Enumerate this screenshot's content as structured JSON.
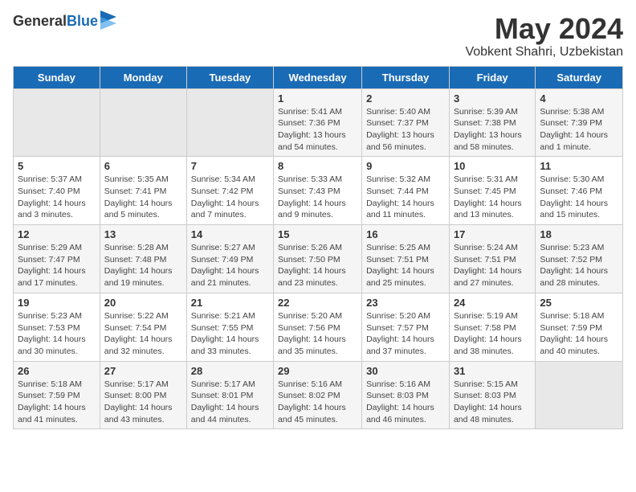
{
  "logo": {
    "general": "General",
    "blue": "Blue"
  },
  "title": "May 2024",
  "location": "Vobkent Shahri, Uzbekistan",
  "days_of_week": [
    "Sunday",
    "Monday",
    "Tuesday",
    "Wednesday",
    "Thursday",
    "Friday",
    "Saturday"
  ],
  "weeks": [
    [
      {
        "day": "",
        "info": ""
      },
      {
        "day": "",
        "info": ""
      },
      {
        "day": "",
        "info": ""
      },
      {
        "day": "1",
        "info": "Sunrise: 5:41 AM\nSunset: 7:36 PM\nDaylight: 13 hours\nand 54 minutes."
      },
      {
        "day": "2",
        "info": "Sunrise: 5:40 AM\nSunset: 7:37 PM\nDaylight: 13 hours\nand 56 minutes."
      },
      {
        "day": "3",
        "info": "Sunrise: 5:39 AM\nSunset: 7:38 PM\nDaylight: 13 hours\nand 58 minutes."
      },
      {
        "day": "4",
        "info": "Sunrise: 5:38 AM\nSunset: 7:39 PM\nDaylight: 14 hours\nand 1 minute."
      }
    ],
    [
      {
        "day": "5",
        "info": "Sunrise: 5:37 AM\nSunset: 7:40 PM\nDaylight: 14 hours\nand 3 minutes."
      },
      {
        "day": "6",
        "info": "Sunrise: 5:35 AM\nSunset: 7:41 PM\nDaylight: 14 hours\nand 5 minutes."
      },
      {
        "day": "7",
        "info": "Sunrise: 5:34 AM\nSunset: 7:42 PM\nDaylight: 14 hours\nand 7 minutes."
      },
      {
        "day": "8",
        "info": "Sunrise: 5:33 AM\nSunset: 7:43 PM\nDaylight: 14 hours\nand 9 minutes."
      },
      {
        "day": "9",
        "info": "Sunrise: 5:32 AM\nSunset: 7:44 PM\nDaylight: 14 hours\nand 11 minutes."
      },
      {
        "day": "10",
        "info": "Sunrise: 5:31 AM\nSunset: 7:45 PM\nDaylight: 14 hours\nand 13 minutes."
      },
      {
        "day": "11",
        "info": "Sunrise: 5:30 AM\nSunset: 7:46 PM\nDaylight: 14 hours\nand 15 minutes."
      }
    ],
    [
      {
        "day": "12",
        "info": "Sunrise: 5:29 AM\nSunset: 7:47 PM\nDaylight: 14 hours\nand 17 minutes."
      },
      {
        "day": "13",
        "info": "Sunrise: 5:28 AM\nSunset: 7:48 PM\nDaylight: 14 hours\nand 19 minutes."
      },
      {
        "day": "14",
        "info": "Sunrise: 5:27 AM\nSunset: 7:49 PM\nDaylight: 14 hours\nand 21 minutes."
      },
      {
        "day": "15",
        "info": "Sunrise: 5:26 AM\nSunset: 7:50 PM\nDaylight: 14 hours\nand 23 minutes."
      },
      {
        "day": "16",
        "info": "Sunrise: 5:25 AM\nSunset: 7:51 PM\nDaylight: 14 hours\nand 25 minutes."
      },
      {
        "day": "17",
        "info": "Sunrise: 5:24 AM\nSunset: 7:51 PM\nDaylight: 14 hours\nand 27 minutes."
      },
      {
        "day": "18",
        "info": "Sunrise: 5:23 AM\nSunset: 7:52 PM\nDaylight: 14 hours\nand 28 minutes."
      }
    ],
    [
      {
        "day": "19",
        "info": "Sunrise: 5:23 AM\nSunset: 7:53 PM\nDaylight: 14 hours\nand 30 minutes."
      },
      {
        "day": "20",
        "info": "Sunrise: 5:22 AM\nSunset: 7:54 PM\nDaylight: 14 hours\nand 32 minutes."
      },
      {
        "day": "21",
        "info": "Sunrise: 5:21 AM\nSunset: 7:55 PM\nDaylight: 14 hours\nand 33 minutes."
      },
      {
        "day": "22",
        "info": "Sunrise: 5:20 AM\nSunset: 7:56 PM\nDaylight: 14 hours\nand 35 minutes."
      },
      {
        "day": "23",
        "info": "Sunrise: 5:20 AM\nSunset: 7:57 PM\nDaylight: 14 hours\nand 37 minutes."
      },
      {
        "day": "24",
        "info": "Sunrise: 5:19 AM\nSunset: 7:58 PM\nDaylight: 14 hours\nand 38 minutes."
      },
      {
        "day": "25",
        "info": "Sunrise: 5:18 AM\nSunset: 7:59 PM\nDaylight: 14 hours\nand 40 minutes."
      }
    ],
    [
      {
        "day": "26",
        "info": "Sunrise: 5:18 AM\nSunset: 7:59 PM\nDaylight: 14 hours\nand 41 minutes."
      },
      {
        "day": "27",
        "info": "Sunrise: 5:17 AM\nSunset: 8:00 PM\nDaylight: 14 hours\nand 43 minutes."
      },
      {
        "day": "28",
        "info": "Sunrise: 5:17 AM\nSunset: 8:01 PM\nDaylight: 14 hours\nand 44 minutes."
      },
      {
        "day": "29",
        "info": "Sunrise: 5:16 AM\nSunset: 8:02 PM\nDaylight: 14 hours\nand 45 minutes."
      },
      {
        "day": "30",
        "info": "Sunrise: 5:16 AM\nSunset: 8:03 PM\nDaylight: 14 hours\nand 46 minutes."
      },
      {
        "day": "31",
        "info": "Sunrise: 5:15 AM\nSunset: 8:03 PM\nDaylight: 14 hours\nand 48 minutes."
      },
      {
        "day": "",
        "info": ""
      }
    ]
  ]
}
